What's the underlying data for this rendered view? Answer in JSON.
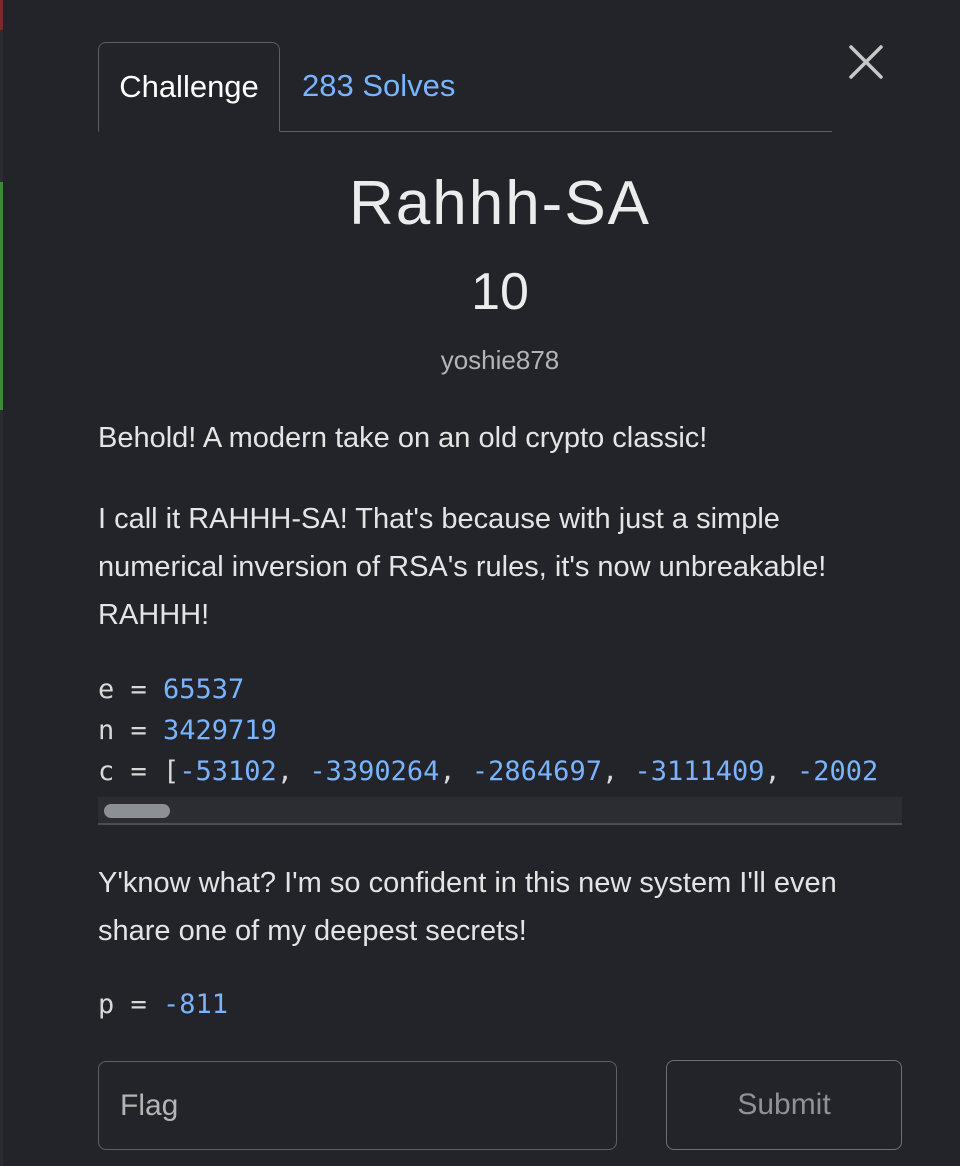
{
  "tabs": {
    "challenge_label": "Challenge",
    "solves_label": "283 Solves"
  },
  "challenge": {
    "name": "Rahhh-SA",
    "points": "10",
    "author": "yoshie878"
  },
  "description": {
    "paragraph_1": "Behold! A modern take on an old crypto classic!",
    "paragraph_2": "I call it RAHHH-SA! That's because with just a simple numerical inversion of RSA's rules, it's now unbreakable! RAHHH!",
    "paragraph_3": "Y'know what? I'm so confident in this new system I'll even share one of my deepest secrets!"
  },
  "code": {
    "e_prefix": "e = ",
    "e_value": "65537",
    "n_prefix": "n = ",
    "n_value": "3429719",
    "c_prefix": "c = [",
    "c_values": [
      "-53102",
      "-3390264",
      "-2864697",
      "-3111409",
      "-2002"
    ],
    "c_separator": ", ",
    "p_prefix": "p = ",
    "p_value": "-811"
  },
  "form": {
    "flag_placeholder": "Flag",
    "flag_value": "",
    "submit_label": "Submit"
  },
  "colors": {
    "background": "#222429",
    "link": "#7ab3ff",
    "number": "#7ab3ff"
  },
  "icons": {
    "close": "close-icon"
  }
}
